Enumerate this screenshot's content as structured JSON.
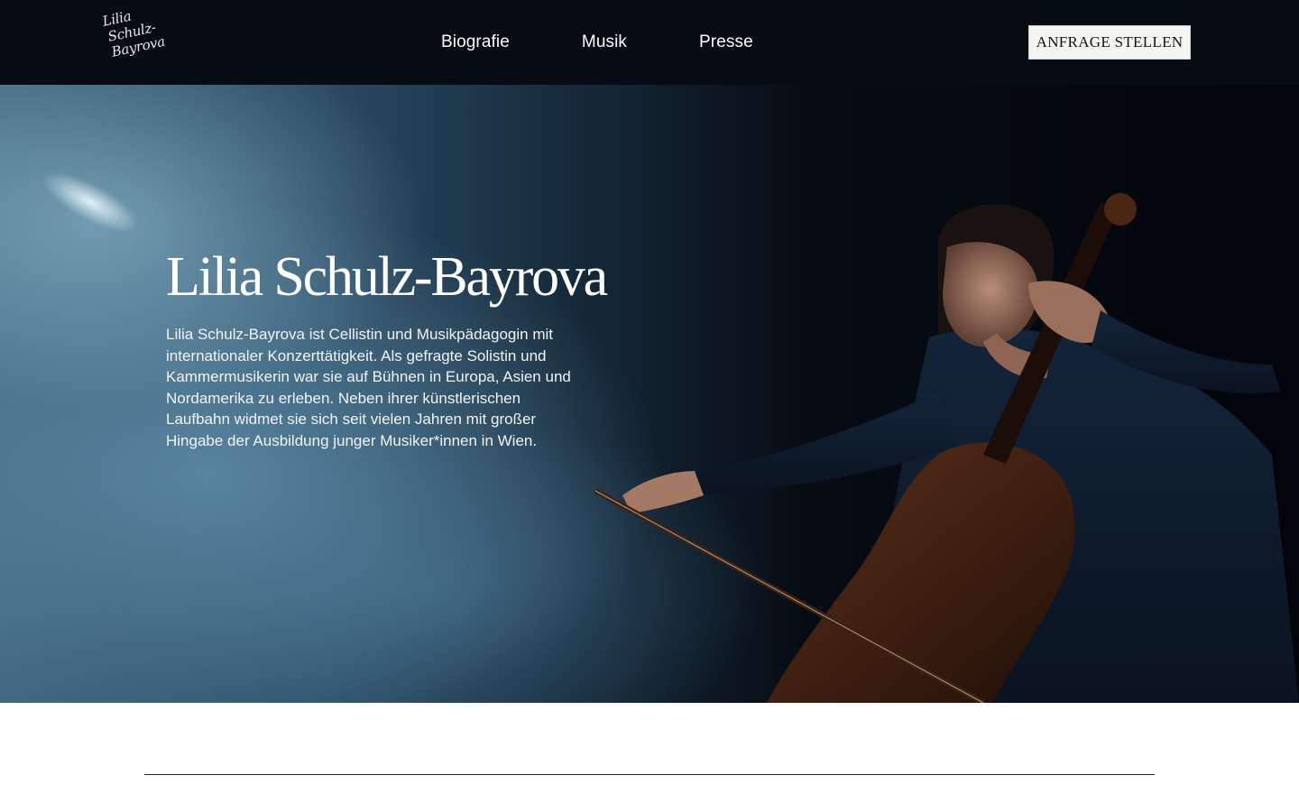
{
  "logo": {
    "line1": "Lilia",
    "line2": "Schulz-",
    "line3": "Bayrova"
  },
  "nav": [
    {
      "label": "Biografie"
    },
    {
      "label": "Musik"
    },
    {
      "label": "Presse"
    }
  ],
  "cta": {
    "label": "ANFRAGE STELLEN"
  },
  "hero": {
    "title": "Lilia Schulz-Bayrova",
    "text": "Lilia Schulz-Bayrova ist Cellistin und Musikpädagogin mit internationaler Konzerttätigkeit. Als gefragte Solistin und Kammermusikerin war sie auf Bühnen in Europa, Asien und Nordamerika zu erleben. Neben ihrer künstlerischen Laufbahn widmet sie sich seit vielen Jahren mit großer Hingabe der Ausbildung junger Musiker*innen in Wien."
  },
  "colors": {
    "header_bg": "#070b12",
    "button_bg": "#f4f4f2",
    "text_light": "#ffffff"
  },
  "icons": {
    "hero_image": "cellist-photo-icon"
  }
}
